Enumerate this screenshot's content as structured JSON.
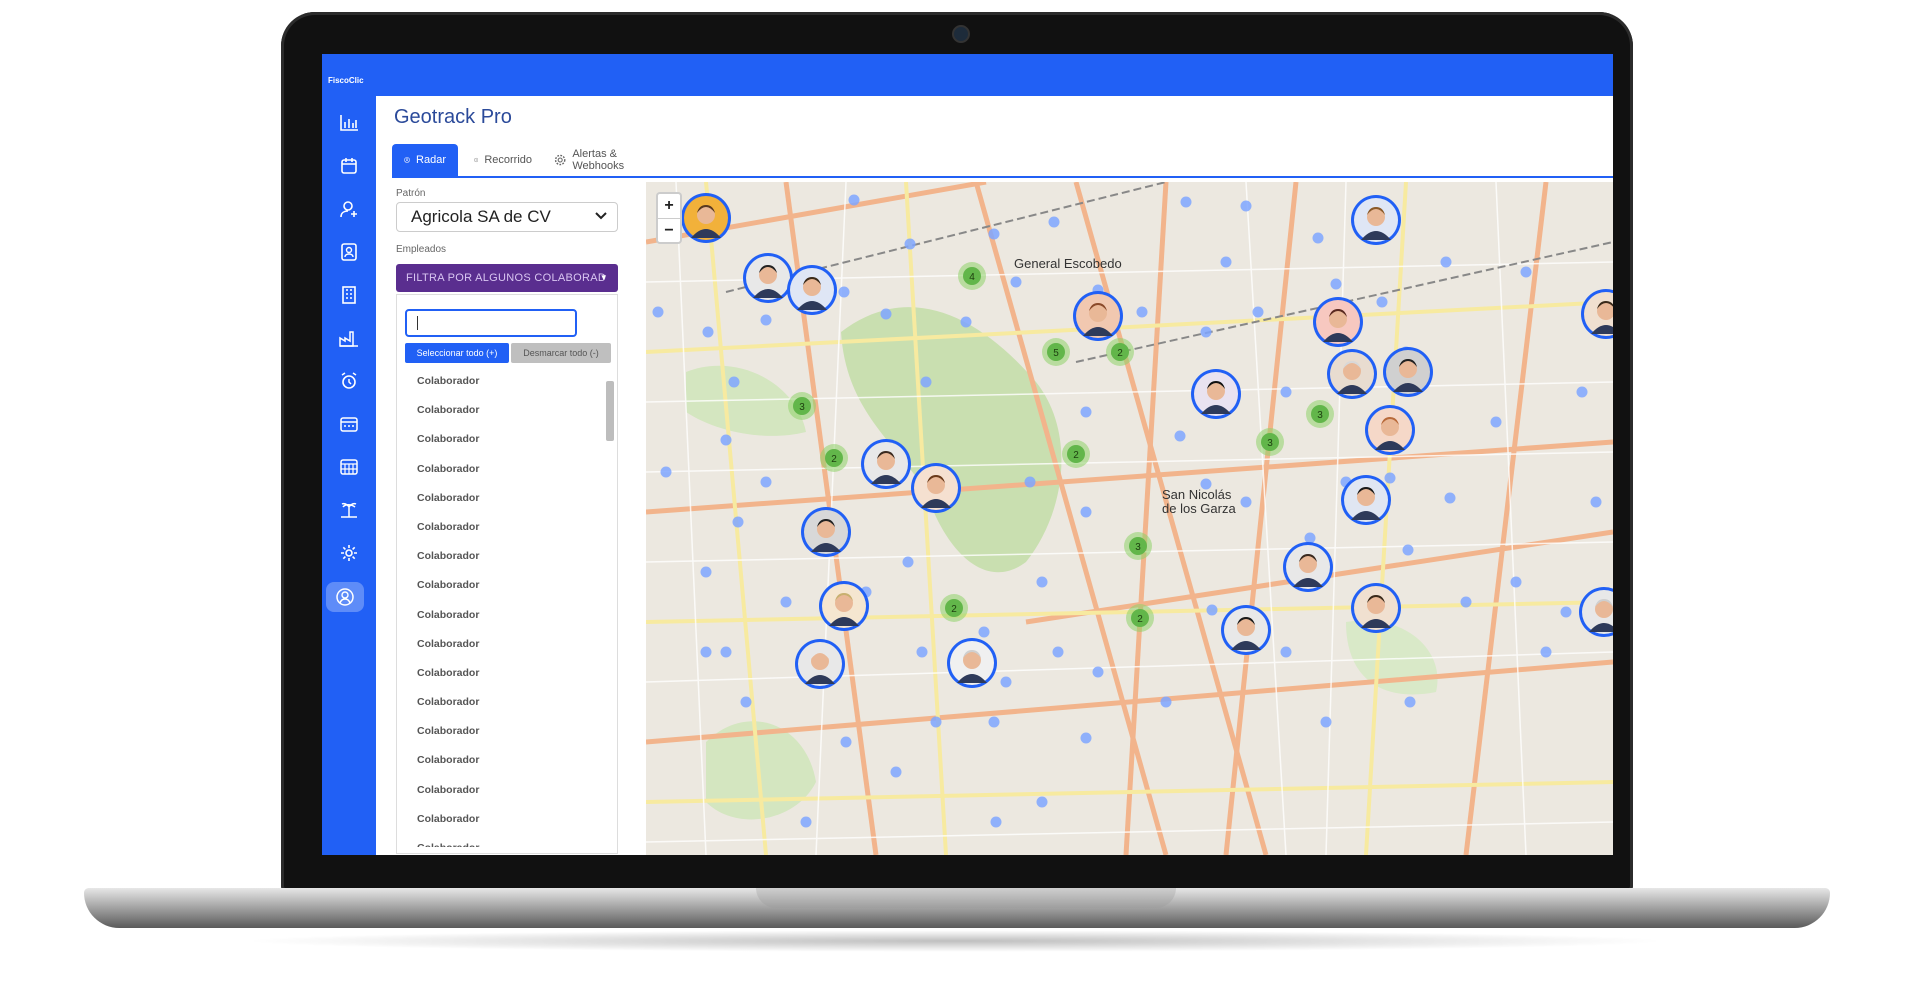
{
  "app": {
    "brand": "FiscoClic",
    "page_title": "Geotrack Pro"
  },
  "tabs": [
    {
      "label": "Radar",
      "icon": "user-circle-icon",
      "active": true
    },
    {
      "label": "Recorrido",
      "icon": "route-icon",
      "active": false
    },
    {
      "label": "Alertas & Webhooks",
      "icon": "gear-icon",
      "active": false
    }
  ],
  "filters": {
    "patron_label": "Patrón",
    "patron_value": "Agricola SA de CV",
    "empleados_label": "Empleados",
    "empleados_button": "FILTRA POR ALGUNOS COLABORAD",
    "select_all": "Seleccionar todo (+)",
    "deselect_all": "Desmarcar todo (-)",
    "items": [
      "Colaborador",
      "Colaborador",
      "Colaborador",
      "Colaborador",
      "Colaborador",
      "Colaborador",
      "Colaborador",
      "Colaborador",
      "Colaborador",
      "Colaborador",
      "Colaborador",
      "Colaborador",
      "Colaborador",
      "Colaborador",
      "Colaborador",
      "Colaborador",
      "Colaborador"
    ]
  },
  "sidebar_icons": [
    "chart-icon",
    "calendar-icon",
    "user-add-icon",
    "contacts-icon",
    "building-icon",
    "factory-icon",
    "alarm-icon",
    "calendar-week-icon",
    "calendar-grid-icon",
    "island-icon",
    "settings-icon",
    "radar-user-icon"
  ],
  "map": {
    "zoom_in": "+",
    "zoom_out": "−",
    "places": [
      "General Escobedo",
      "San Nicolás de los Garza"
    ],
    "clusters": [
      "4",
      "5",
      "2",
      "3",
      "2",
      "2",
      "3",
      "3",
      "3",
      "2",
      "2"
    ]
  },
  "colors": {
    "primary": "#2160f5",
    "filter_button": "#5a2e8f",
    "cluster": "#8fd16a",
    "marker_dot": "#7fa6ff"
  }
}
